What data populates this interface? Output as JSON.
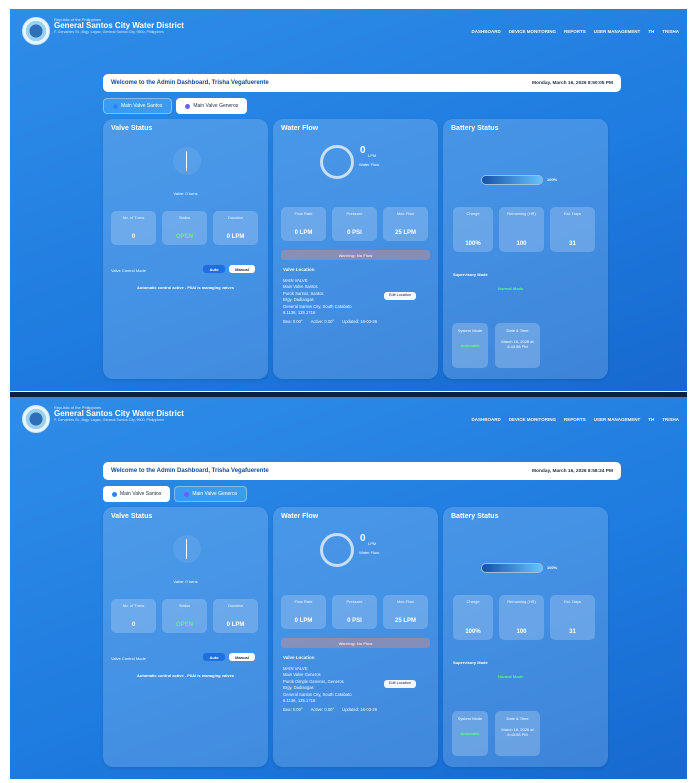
{
  "header": {
    "sub": "Republic of the Philippines",
    "title": "General Santos City Water District",
    "address": "F. Cervantes St., Brgy. Lagao, General Santos City, 9500, Philippines"
  },
  "nav": [
    "DASHBOARD",
    "DEVICE MONITORING",
    "REPORTS",
    "USER MANAGEMENT",
    "TH",
    "TRISHA"
  ],
  "screens": [
    {
      "welcome": "Welcome to the Admin Dashboard, Trisha Vegafuerente",
      "datetime": "Monday, March 16, 2026 8:50:05 PM",
      "tabs": [
        "Main Valve Santos",
        "Main Valve Generos"
      ],
      "active_tab": 0,
      "valve": {
        "title": "Valve Status",
        "gauge_label": "Valve: 0 turns",
        "stats": [
          {
            "label": "No. of Turns",
            "value": "0"
          },
          {
            "label": "Status",
            "value": "OPEN"
          },
          {
            "label": "Duration",
            "value": "0 LPM"
          }
        ],
        "control_label": "Valve Control Mode",
        "auto": "Auto",
        "manual": "Manual",
        "note": "Automatic control active - PI/AI is managing valves"
      },
      "flow": {
        "title": "Water Flow",
        "value": "0",
        "unit": "LPM",
        "caption": "Water Flow",
        "stats": [
          {
            "label": "Flow Rate",
            "value": "0 LPM"
          },
          {
            "label": "Pressure",
            "value": "0 PSI"
          },
          {
            "label": "Max Flow",
            "value": "25 LPM"
          }
        ],
        "warning": "Warning: No Flow",
        "loc_title": "Valve Location",
        "loc_lines": [
          "MAIN VALVE",
          "Main Valve Santos",
          "Purok Santos, Santos",
          "Brgy. Dadiangas",
          "General Santos City, South Cotabato",
          "6.1136, 125.1716"
        ],
        "edit": "Edit Location",
        "foot": [
          "Bea: 0.00°",
          "Active: 0.00°",
          "Updated: 16-03-26"
        ]
      },
      "battery": {
        "title": "Battery Status",
        "level": 1.0,
        "level_text": "100%",
        "stats": [
          {
            "label": "Charge",
            "value": "100%"
          },
          {
            "label": "Remaining (HR)",
            "value": "100"
          },
          {
            "label": "Est. Days",
            "value": "31"
          }
        ],
        "sup_title": "Supervisory Mode",
        "sup_status": "Normal Mode",
        "sys_label": "System Mode",
        "sys_value": "Automatic",
        "date_label": "Date & Time",
        "date_value": "March 16, 2026 at 8:43:58 PM"
      }
    },
    {
      "welcome": "Welcome to the Admin Dashboard, Trisha Vegafuerente",
      "datetime": "Monday, March 16, 2026 8:58:24 PM",
      "tabs": [
        "Main Valve Santos",
        "Main Valve Generos"
      ],
      "active_tab": 0,
      "valve": {
        "title": "Valve Status",
        "gauge_label": "Valve: 0 turns",
        "stats": [
          {
            "label": "No. of Turns",
            "value": "0"
          },
          {
            "label": "Status",
            "value": "OPEN"
          },
          {
            "label": "Duration",
            "value": "0 LPM"
          }
        ],
        "control_label": "Valve Control Mode",
        "auto": "Auto",
        "manual": "Manual",
        "note": "Automatic control active - PI/AI is managing valves"
      },
      "flow": {
        "title": "Water Flow",
        "value": "0",
        "unit": "LPM",
        "caption": "Water Flow",
        "stats": [
          {
            "label": "Flow Rate",
            "value": "0 LPM"
          },
          {
            "label": "Pressure",
            "value": "0 PSI"
          },
          {
            "label": "Max Flow",
            "value": "25 LPM"
          }
        ],
        "warning": "Warning: No Flow",
        "loc_title": "Valve Location",
        "loc_lines": [
          "MAIN VALVE",
          "Main Valve Generos",
          "Purok Dimple Generos, Generos",
          "Brgy. Dadiangas",
          "General Santos City, South Cotabato",
          "6.1136, 125.1716"
        ],
        "edit": "Edit Location",
        "foot": [
          "Bea: 0.00°",
          "Active: 0.00°",
          "Updated: 16-03-26"
        ]
      },
      "battery": {
        "title": "Battery Status",
        "level": 1.0,
        "level_text": "100%",
        "stats": [
          {
            "label": "Charge",
            "value": "100%"
          },
          {
            "label": "Remaining (HR)",
            "value": "100"
          },
          {
            "label": "Est. Days",
            "value": "31"
          }
        ],
        "sup_title": "Supervisory Mode",
        "sup_status": "Normal Mode",
        "sys_label": "System Mode",
        "sys_value": "Automatic",
        "date_label": "Date & Time",
        "date_value": "March 16, 2026 at 8:43:58 PM"
      }
    }
  ]
}
